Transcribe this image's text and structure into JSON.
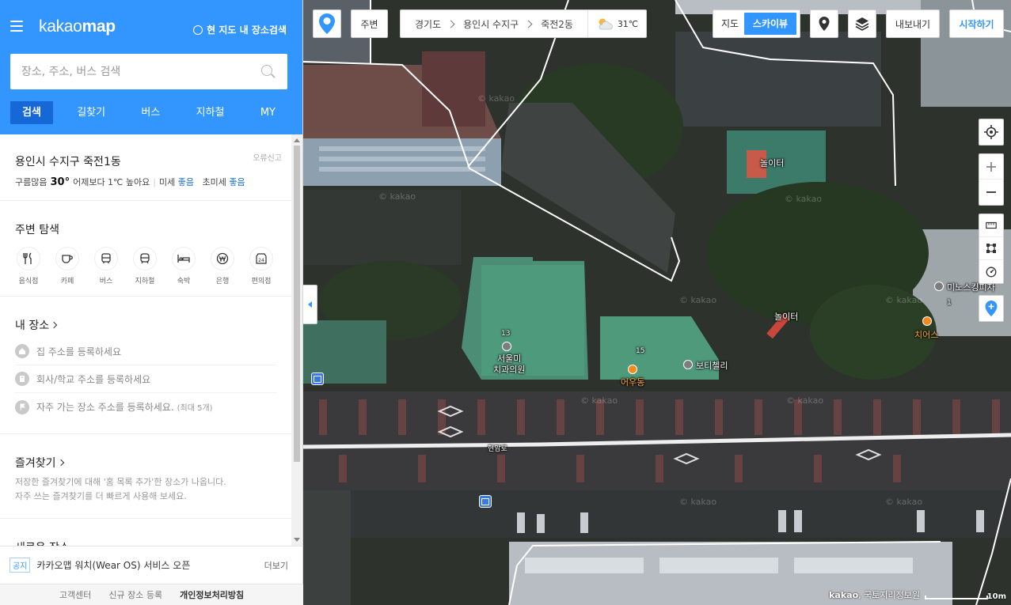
{
  "header": {
    "logo_light": "kakao",
    "logo_bold": "map",
    "area_search": "현 지도 내 장소검색",
    "search_placeholder": "장소, 주소, 버스 검색",
    "tabs": [
      {
        "label": "검색",
        "active": true
      },
      {
        "label": "길찾기",
        "active": false
      },
      {
        "label": "버스",
        "active": false
      },
      {
        "label": "지하철",
        "active": false
      },
      {
        "label": "MY",
        "active": false
      }
    ]
  },
  "weather": {
    "location": "용인시 수지구 죽전1동",
    "report": "오류신고",
    "condition": "구름많음",
    "temp": "30°",
    "compare": "어제보다 1℃ 높아요",
    "fine_dust_label": "미세",
    "fine_dust_value": "좋음",
    "ultrafine_label": "초미세",
    "ultrafine_value": "좋음"
  },
  "nearby": {
    "title": "주변 탐색",
    "categories": [
      {
        "label": "음식점",
        "icon": "utensils-icon"
      },
      {
        "label": "카페",
        "icon": "coffee-cup-icon"
      },
      {
        "label": "버스",
        "icon": "bus-icon"
      },
      {
        "label": "지하철",
        "icon": "subway-icon"
      },
      {
        "label": "숙박",
        "icon": "bed-icon"
      },
      {
        "label": "은행",
        "icon": "won-icon"
      },
      {
        "label": "편의점",
        "icon": "store-24-icon"
      }
    ]
  },
  "my_place": {
    "title": "내 장소",
    "items": [
      {
        "text": "집 주소를 등록하세요",
        "extra": "",
        "icon": "home-icon"
      },
      {
        "text": "회사/학교 주소를 등록하세요",
        "extra": "",
        "icon": "building-icon"
      },
      {
        "text": "자주 가는 장소 주소를 등록하세요.",
        "extra": "(최대 5개)",
        "icon": "flag-icon"
      }
    ]
  },
  "favorites": {
    "title": "즐겨찾기",
    "desc1": "저장한 즐겨찾기에 대해 '홈 목록 추가'한 장소가 나옵니다.",
    "desc2": "자주 쓰는 즐겨찾기를 더 빠르게 사용해 보세요."
  },
  "recent": {
    "title": "새로운 장소"
  },
  "notice": {
    "badge": "공지",
    "text": "카카오맵 워치(Wear OS) 서비스 오픈",
    "more": "더보기"
  },
  "footer": {
    "links": [
      "고객센터",
      "신규 장소 등록",
      "개인정보처리방침"
    ]
  },
  "map": {
    "nearby_btn": "주변",
    "breadcrumb": [
      "경기도",
      "용인시 수지구",
      "죽전2동"
    ],
    "weather_temp": "31℃",
    "map_types": [
      {
        "label": "지도",
        "active": false
      },
      {
        "label": "스카이뷰",
        "active": true
      }
    ],
    "export_btn": "내보내기",
    "start_btn": "시작하기",
    "copyright_brand": "kakao",
    "copyright_text": ", 국토지리정보원",
    "scale": "10m",
    "watermark": "© kakao",
    "labels": {
      "playground1": "놀이터",
      "playground2": "놀이터",
      "dental_line1": "서울미",
      "dental_line2": "치과의원",
      "dental_floor": "13",
      "udong": "어우동",
      "udong_floor": "15",
      "boti": "보티첼리",
      "minos": "미노스킹피자",
      "minos_floor": "1",
      "chirus": "치어스",
      "road": "현암로"
    }
  },
  "colors": {
    "brand_blue": "#3396ff",
    "tab_active": "#1568d6",
    "poi_orange": "#f28a1d"
  }
}
